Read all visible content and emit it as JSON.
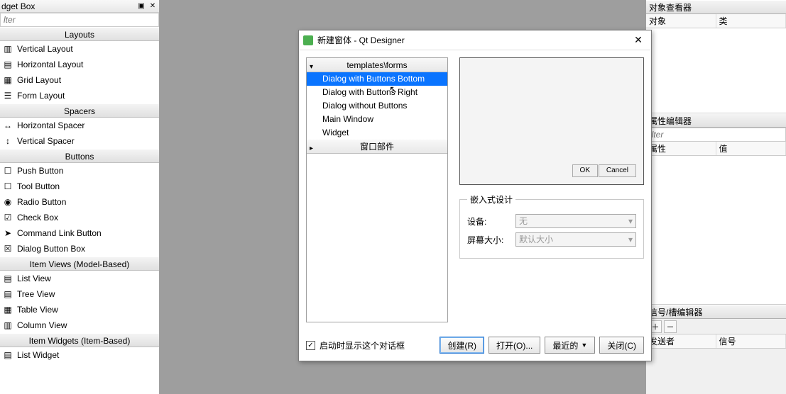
{
  "widgetbox": {
    "title": "dget Box",
    "filter_placeholder": "lter",
    "categories": [
      {
        "label": "Layouts",
        "items": [
          "Vertical Layout",
          "Horizontal Layout",
          "Grid Layout",
          "Form Layout"
        ]
      },
      {
        "label": "Spacers",
        "items": [
          "Horizontal Spacer",
          "Vertical Spacer"
        ]
      },
      {
        "label": "Buttons",
        "items": [
          "Push Button",
          "Tool Button",
          "Radio Button",
          "Check Box",
          "Command Link Button",
          "Dialog Button Box"
        ]
      },
      {
        "label": "Item Views (Model-Based)",
        "items": [
          "List View",
          "Tree View",
          "Table View",
          "Column View"
        ]
      },
      {
        "label": "Item Widgets (Item-Based)",
        "items": [
          "List Widget"
        ]
      }
    ]
  },
  "dialog": {
    "title": "新建窗体 - Qt Designer",
    "tree_header_forms": "templates\\forms",
    "tree_items": [
      "Dialog with Buttons Bottom",
      "Dialog with Buttons Right",
      "Dialog without Buttons",
      "Main Window",
      "Widget"
    ],
    "tree_header_widgets": "窗口部件",
    "preview_ok": "OK",
    "preview_cancel": "Cancel",
    "embed_title": "嵌入式设计",
    "device_label": "设备:",
    "device_value": "无",
    "size_label": "屏幕大小:",
    "size_value": "默认大小",
    "show_on_start": "启动时显示这个对话框",
    "btn_create": "创建(R)",
    "btn_open": "打开(O)...",
    "btn_recent": "最近的",
    "btn_close": "关闭(C)"
  },
  "right": {
    "object_viewer": "对象查看器",
    "obj_col_object": "对象",
    "obj_col_class": "类",
    "property_editor": "属性编辑器",
    "prop_filter_placeholder": "ilter",
    "prop_col_name": "属性",
    "prop_col_value": "值",
    "slot_editor": "信号/槽编辑器",
    "sig_col_sender": "发送者",
    "sig_col_signal": "信号"
  }
}
